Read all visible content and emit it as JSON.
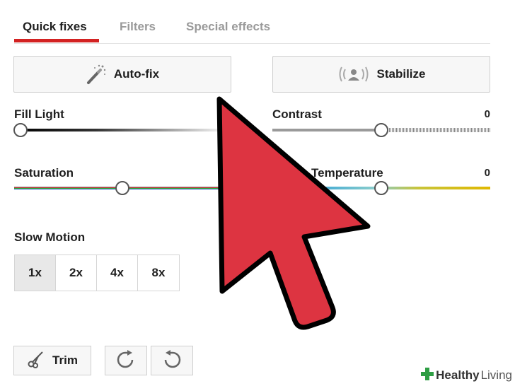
{
  "tabs": [
    {
      "label": "Quick fixes",
      "active": true
    },
    {
      "label": "Filters",
      "active": false
    },
    {
      "label": "Special effects",
      "active": false
    }
  ],
  "buttons": {
    "autofix": {
      "label": "Auto-fix",
      "icon": "magic-wand-icon"
    },
    "stabilize": {
      "label": "Stabilize",
      "icon": "stabilize-icon"
    }
  },
  "sliders": {
    "fill_light": {
      "label": "Fill Light",
      "value": "",
      "position": 0.0
    },
    "contrast": {
      "label": "Contrast",
      "value": "0",
      "position": 0.5
    },
    "saturation": {
      "label": "Saturation",
      "value": "",
      "position": 0.5
    },
    "temperature": {
      "label": "Temperature",
      "value": "0",
      "position": 0.5
    }
  },
  "slow_motion": {
    "label": "Slow Motion",
    "options": [
      "1x",
      "2x",
      "4x",
      "8x"
    ],
    "selected": "1x"
  },
  "tools": {
    "trim": {
      "label": "Trim",
      "icon": "scissors-icon"
    },
    "rotate_right": {
      "icon": "rotate-right-icon"
    },
    "rotate_left": {
      "icon": "rotate-left-icon"
    }
  },
  "overlay": {
    "icon": "red-arrow-cursor-icon",
    "color": "#dd3441"
  },
  "watermark": {
    "brand": "Healthy",
    "brand_suffix": "Living",
    "icon": "cross-icon",
    "color": "#2e9e44"
  },
  "colors": {
    "accent": "#d32222"
  }
}
